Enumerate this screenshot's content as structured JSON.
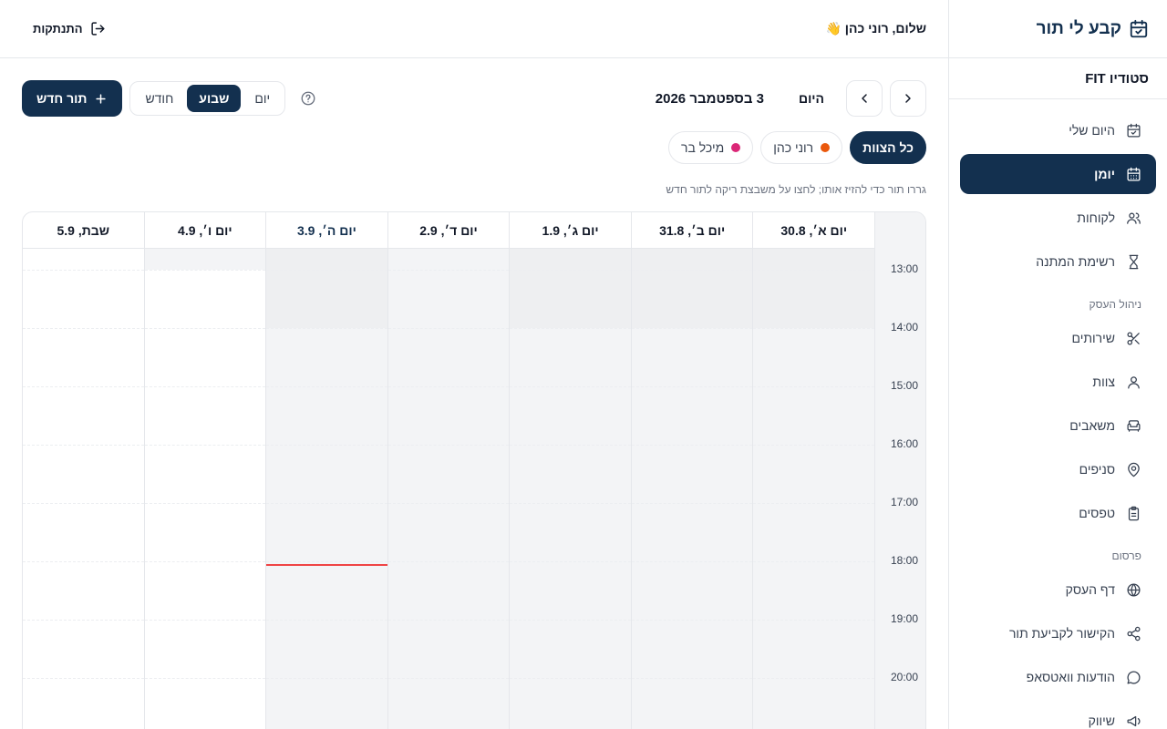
{
  "app": {
    "name": "קבע לי תור",
    "studio": "סטודיו FIT"
  },
  "sidebar": {
    "items": [
      {
        "label": "היום שלי",
        "icon": "calendar-check-icon"
      },
      {
        "label": "יומן",
        "icon": "calendar-icon",
        "active": true
      },
      {
        "label": "לקוחות",
        "icon": "users-icon"
      },
      {
        "label": "רשימת המתנה",
        "icon": "hourglass-icon"
      }
    ],
    "section_business": "ניהול העסק",
    "business_items": [
      {
        "label": "שירותים",
        "icon": "scissors-icon"
      },
      {
        "label": "צוות",
        "icon": "user-icon"
      },
      {
        "label": "משאבים",
        "icon": "armchair-icon"
      },
      {
        "label": "סניפים",
        "icon": "map-pin-icon"
      },
      {
        "label": "טפסים",
        "icon": "clipboard-icon"
      }
    ],
    "section_marketing": "פרסום",
    "marketing_items": [
      {
        "label": "דף העסק",
        "icon": "globe-icon"
      },
      {
        "label": "הקישור לקביעת תור",
        "icon": "share-icon"
      },
      {
        "label": "הודעות וואטסאפ",
        "icon": "message-icon"
      },
      {
        "label": "שיווק",
        "icon": "megaphone-icon"
      }
    ]
  },
  "header": {
    "greeting": "שלום, רוני כהן 👋",
    "logout": "התנתקות"
  },
  "toolbar": {
    "today": "היום",
    "date_title": "3 בספטמבר 2026",
    "views": [
      "יום",
      "שבוע",
      "חודש"
    ],
    "active_view": "שבוע",
    "new_appointment": "תור חדש"
  },
  "staff_filters": [
    {
      "label": "כל הצוות",
      "active": true,
      "color": ""
    },
    {
      "label": "רוני כהן",
      "active": false,
      "color": "#ea580c"
    },
    {
      "label": "מיכל בר",
      "active": false,
      "color": "#db2777"
    }
  ],
  "hint": "גררו תור כדי להזיז אותו; לחצו על משבצת ריקה לתור חדש",
  "calendar": {
    "days": [
      "יום א׳, 30.8",
      "יום ב׳, 31.8",
      "יום ג׳, 1.9",
      "יום ד׳, 2.9",
      "יום ה׳, 3.9",
      "יום ו׳, 4.9",
      "שבת, 5.9"
    ],
    "today_index": 4,
    "hours": [
      "13:00",
      "14:00",
      "15:00",
      "16:00",
      "17:00",
      "18:00",
      "19:00",
      "20:00"
    ],
    "now": "17:55",
    "colors": {
      "primary": "#13304f",
      "now_line": "#ef4444"
    }
  }
}
